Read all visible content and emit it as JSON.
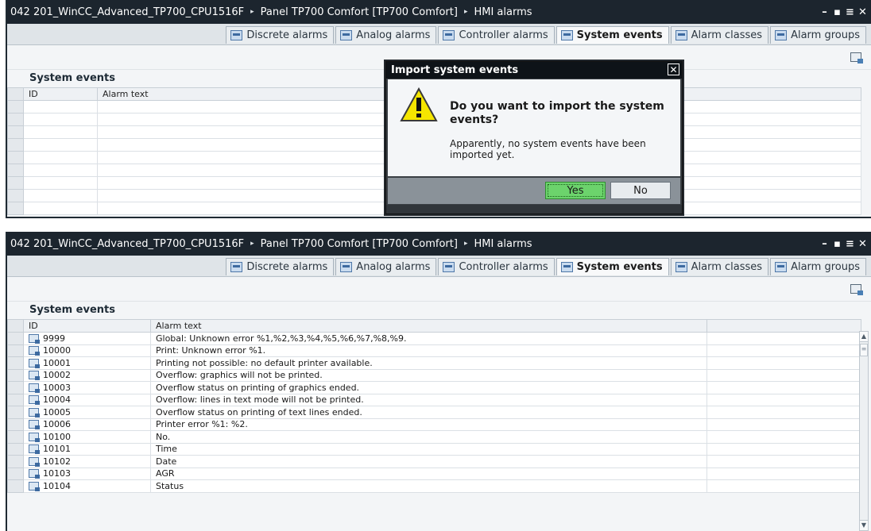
{
  "breadcrumb": {
    "project": "042 201_WinCC_Advanced_TP700_CPU1516F",
    "device": "Panel TP700 Comfort [TP700 Comfort]",
    "editor": "HMI alarms"
  },
  "tabs": [
    {
      "label": "Discrete alarms"
    },
    {
      "label": "Analog alarms"
    },
    {
      "label": "Controller alarms"
    },
    {
      "label": "System events"
    },
    {
      "label": "Alarm classes"
    },
    {
      "label": "Alarm groups"
    }
  ],
  "active_tab": "System events",
  "section_title": "System events",
  "columns": {
    "id": "ID",
    "text": "Alarm text"
  },
  "dialog": {
    "title": "Import system events",
    "question": "Do you want to import the system events?",
    "info": "Apparently, no system events have been imported yet.",
    "yes_label": "Yes",
    "no_label": "No",
    "close_glyph": "✕"
  },
  "events": [
    {
      "id": "9999",
      "text": "Global: Unknown error %1,%2,%3,%4,%5,%6,%7,%8,%9."
    },
    {
      "id": "10000",
      "text": "Print: Unknown error %1."
    },
    {
      "id": "10001",
      "text": "Printing not possible: no default printer available."
    },
    {
      "id": "10002",
      "text": "Overflow: graphics will not be printed."
    },
    {
      "id": "10003",
      "text": "Overflow status on printing of graphics ended."
    },
    {
      "id": "10004",
      "text": "Overflow: lines in text mode will not be printed."
    },
    {
      "id": "10005",
      "text": "Overflow status on printing of text lines ended."
    },
    {
      "id": "10006",
      "text": "Printer error %1: %2."
    },
    {
      "id": "10100",
      "text": "No."
    },
    {
      "id": "10101",
      "text": "Time"
    },
    {
      "id": "10102",
      "text": "Date"
    },
    {
      "id": "10103",
      "text": "AGR"
    },
    {
      "id": "10104",
      "text": "Status"
    }
  ],
  "icons": {
    "separator": "▸",
    "window_controls": [
      "minimize-icon",
      "float-icon",
      "maximize-icon",
      "close-icon"
    ],
    "row_icon": "system-event-icon"
  },
  "colors": {
    "title_bar": "#1c252e",
    "dialog_title": "#0e1318",
    "yes_button": "#6cd36c",
    "warning": "#f5e600"
  }
}
